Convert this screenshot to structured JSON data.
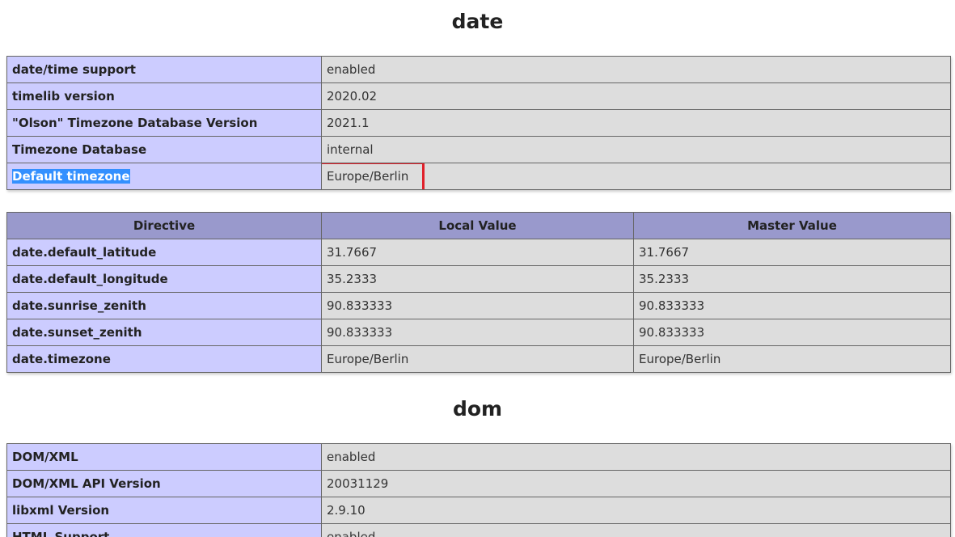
{
  "sections": {
    "date": {
      "title": "date",
      "info_rows": [
        {
          "label": "date/time support",
          "value": "enabled"
        },
        {
          "label": "timelib version",
          "value": "2020.02"
        },
        {
          "label": "\"Olson\" Timezone Database Version",
          "value": "2021.1"
        },
        {
          "label": "Timezone Database",
          "value": "internal"
        },
        {
          "label": "Default timezone",
          "value": "Europe/Berlin"
        }
      ],
      "directive_headers": [
        "Directive",
        "Local Value",
        "Master Value"
      ],
      "directives": [
        {
          "name": "date.default_latitude",
          "local": "31.7667",
          "master": "31.7667"
        },
        {
          "name": "date.default_longitude",
          "local": "35.2333",
          "master": "35.2333"
        },
        {
          "name": "date.sunrise_zenith",
          "local": "90.833333",
          "master": "90.833333"
        },
        {
          "name": "date.sunset_zenith",
          "local": "90.833333",
          "master": "90.833333"
        },
        {
          "name": "date.timezone",
          "local": "Europe/Berlin",
          "master": "Europe/Berlin"
        }
      ]
    },
    "dom": {
      "title": "dom",
      "info_rows": [
        {
          "label": "DOM/XML",
          "value": "enabled"
        },
        {
          "label": "DOM/XML API Version",
          "value": "20031129"
        },
        {
          "label": "libxml Version",
          "value": "2.9.10"
        },
        {
          "label": "HTML Support",
          "value": "enabled"
        }
      ]
    }
  },
  "colors": {
    "label_cell": "#ccccff",
    "value_cell": "#dddddd",
    "header_cell": "#9999cc",
    "selection": "#3390ff",
    "annotation_box": "#e0202a"
  }
}
